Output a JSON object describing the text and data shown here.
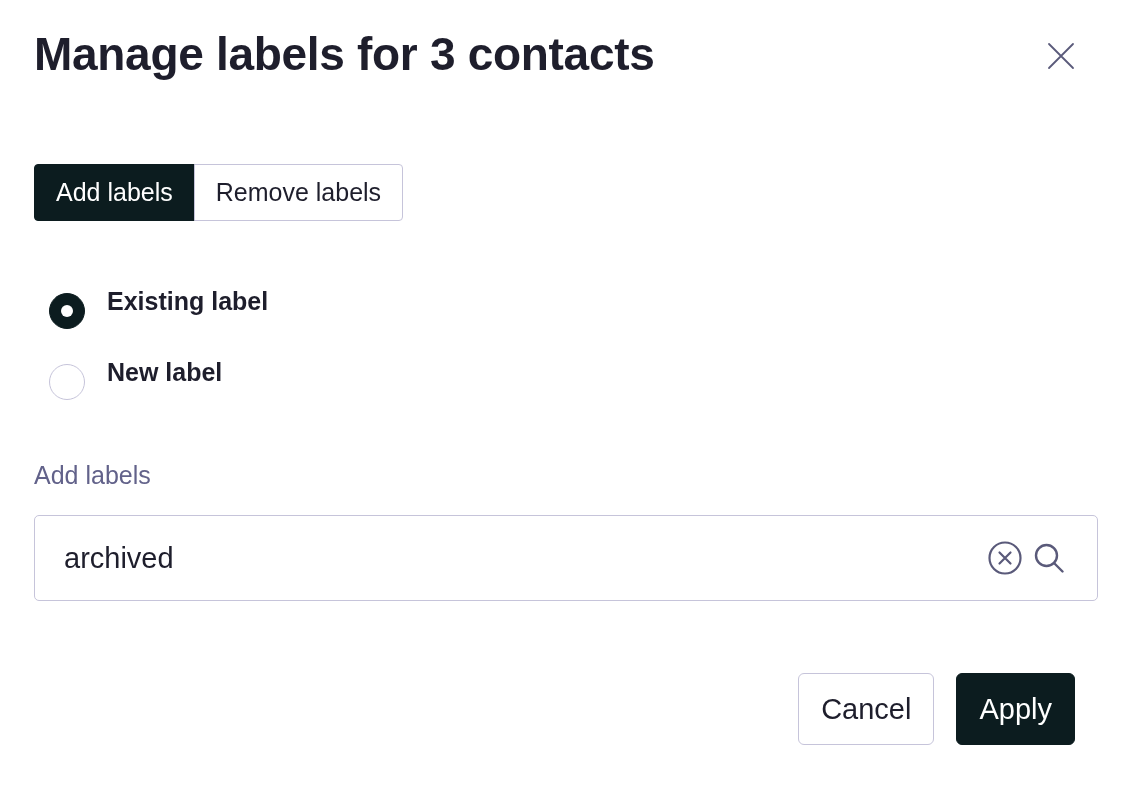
{
  "dialog": {
    "title": "Manage labels for 3 contacts"
  },
  "tabs": [
    {
      "label": "Add labels",
      "selected": true
    },
    {
      "label": "Remove labels",
      "selected": false
    }
  ],
  "options": [
    {
      "label": "Existing label",
      "selected": true
    },
    {
      "label": "New label",
      "selected": false
    }
  ],
  "field": {
    "label": "Add labels",
    "value": "archived"
  },
  "buttons": [
    {
      "label": "Cancel",
      "kind": "secondary"
    },
    {
      "label": "Apply",
      "kind": "primary"
    }
  ]
}
